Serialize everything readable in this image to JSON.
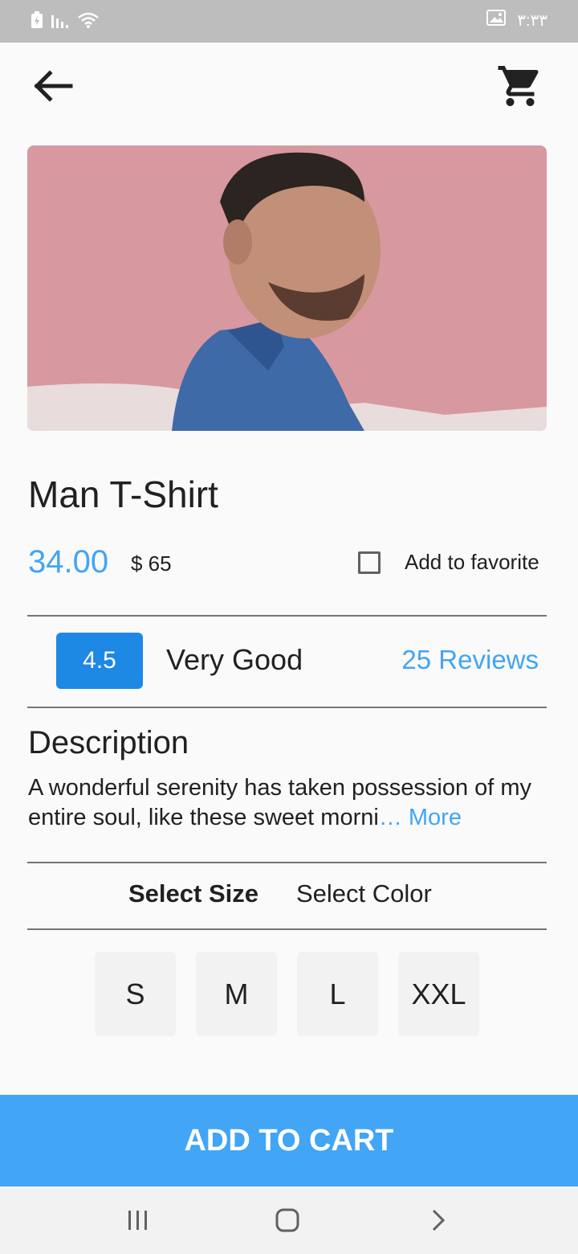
{
  "status_bar": {
    "time": "٣:٣٣",
    "icons": [
      "battery-charging-icon",
      "signal-bars-icon",
      "wifi-icon",
      "image-notification-icon"
    ]
  },
  "app_bar": {
    "back_icon": "arrow-left-icon",
    "cart_icon": "shopping-cart-icon"
  },
  "product": {
    "title": "Man T-Shirt",
    "price": "34.00",
    "old_price": "$ 65",
    "favorite_label": "Add to favorite",
    "favorite_checked": false,
    "rating": "4.5",
    "rating_text": "Very Good",
    "reviews": "25 Reviews"
  },
  "description": {
    "title": "Description",
    "text": "A wonderful serenity has taken possession of my entire soul, like these sweet morni",
    "ellipsis": "…",
    "more_label": " More"
  },
  "tabs": {
    "size_label": "Select Size",
    "color_label": "Select Color",
    "active": "size"
  },
  "sizes": [
    "S",
    "M",
    "L",
    "XXL"
  ],
  "cta_label": "ADD TO CART",
  "nav": [
    "recent-apps-icon",
    "home-icon",
    "back-chevron-icon"
  ],
  "colors": {
    "accent": "#42a5f5",
    "badge": "#1e88e5",
    "status_bar": "#bdbdbd",
    "background": "#fafafa"
  }
}
